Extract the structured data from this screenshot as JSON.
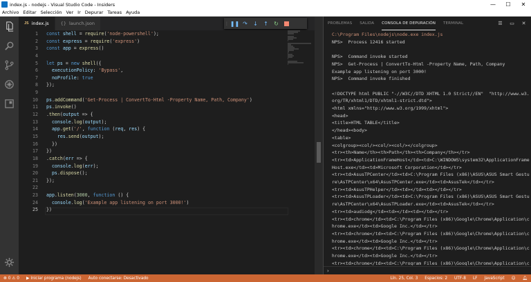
{
  "window": {
    "title": "index.js - nodejs - Visual Studio Code - Insiders",
    "controls": {
      "minimize": "—",
      "maximize": "☐",
      "close": "✕"
    }
  },
  "menu": [
    "Archivo",
    "Editar",
    "Selección",
    "Ver",
    "Ir",
    "Depurar",
    "Tareas",
    "Ayuda"
  ],
  "tabs": [
    {
      "badge": "JS",
      "label": "index.js"
    },
    {
      "label": "launch.json"
    }
  ],
  "editor": {
    "line_numbers": [
      "1",
      "2",
      "3",
      "4",
      "5",
      "6",
      "7",
      "8",
      "9",
      "10",
      "11",
      "12",
      "13",
      "14",
      "15",
      "16",
      "17",
      "18",
      "19",
      "20",
      "21",
      "22",
      "23",
      "24",
      "25"
    ],
    "current_line": "25",
    "code": [
      "const shell = require('node-powershell');",
      "const express = require('express')",
      "const app = express()",
      "",
      "let ps = new shell({",
      "  executionPolicy: 'Bypass',",
      "  noProfile: true",
      "});",
      "",
      "ps.addCommand('Get-Process | ConvertTo-Html -Property Name, Path, Company')",
      "ps.invoke()",
      ".then(output => {",
      "  console.log(output);",
      "  app.get('/', function (req, res) {",
      "    res.send(output);",
      "  })",
      "})",
      ".catch(err => {",
      "  console.log(err);",
      "  ps.dispose();",
      "});",
      "",
      "app.listen(3000, function () {",
      "  console.log('Example app listening on port 3000!')",
      "})"
    ]
  },
  "panel": {
    "tabs": [
      "PROBLEMAS",
      "SALIDA",
      "CONSOLA DE DEPURACIÓN",
      "TERMINAL"
    ],
    "active_tab": "CONSOLA DE DEPURACIÓN",
    "console_lines": [
      "C:\\Program Files\\nodejs\\node.exe index.js",
      "NPS>  Process 12416 started",
      "",
      "NPS>  Command invoke started",
      "NPS>  Get-Process | ConvertTo-Html -Property Name, Path, Company",
      "Example app listening on port 3000!",
      "NPS>  Command invoke finished",
      "",
      "<!DOCTYPE html PUBLIC \"-//W3C//DTD XHTML 1.0 Strict//EN\"  \"http://www.w3.org/TR/xhtml1/DTD/xhtml1-strict.dtd\">",
      "<html xmlns=\"http://www.w3.org/1999/xhtml\">",
      "<head>",
      "<title>HTML TABLE</title>",
      "</head><body>",
      "<table>",
      "<colgroup><col/><col/><col/></colgroup>",
      "<tr><th>Name</th><th>Path</th><th>Company</th></tr>",
      "<tr><td>ApplicationFrameHost</td><td>C:\\WINDOWS\\system32\\ApplicationFrameHost.exe</td><td>Microsoft Corporation</td></tr>",
      "<tr><td>AsusTPCenter</td><td>C:\\Program Files (x86)\\ASUS\\ASUS Smart Gesture\\AsTPCenter\\x64\\AsusTPCenter.exe</td><td>AsusTek</td></tr>",
      "<tr><td>AsusTPHelper</td><td></td><td></td></tr>",
      "<tr><td>AsusTPLoader</td><td>C:\\Program Files (x86)\\ASUS\\ASUS Smart Gesture\\AsTPCenter\\x64\\AsusTPLoader.exe</td><td>AsusTek</td></tr>",
      "<tr><td>audiodg</td><td></td><td></td></tr>",
      "<tr><td>chrome</td><td>C:\\Program Files (x86)\\Google\\Chrome\\Application\\chrome.exe</td><td>Google Inc.</td></tr>",
      "<tr><td>chrome</td><td>C:\\Program Files (x86)\\Google\\Chrome\\Application\\chrome.exe</td><td>Google Inc.</td></tr>",
      "<tr><td>chrome</td><td>C:\\Program Files (x86)\\Google\\Chrome\\Application\\chrome.exe</td><td>Google Inc.</td></tr>",
      "<tr><td>chrome</td><td>C:\\Program Files (x86)\\Google\\Chrome\\Application\\chrome.exe</td><td>Google Inc.</td></tr>"
    ],
    "repl_prompt": "›"
  },
  "statusbar": {
    "errors": "0",
    "warnings": "0",
    "debug_label": "Iniciar programa (nodejs)",
    "auto_attach": "Auto conectarse: Desactivado",
    "position": "Lín. 25, Col. 3",
    "indent": "Espacios: 2",
    "encoding": "UTF-8",
    "eol": "LF",
    "language": "JavaScript"
  },
  "colors": {
    "statusbar": "#cc6633",
    "activity": "#333333",
    "editor_bg": "#1e1e1e"
  }
}
